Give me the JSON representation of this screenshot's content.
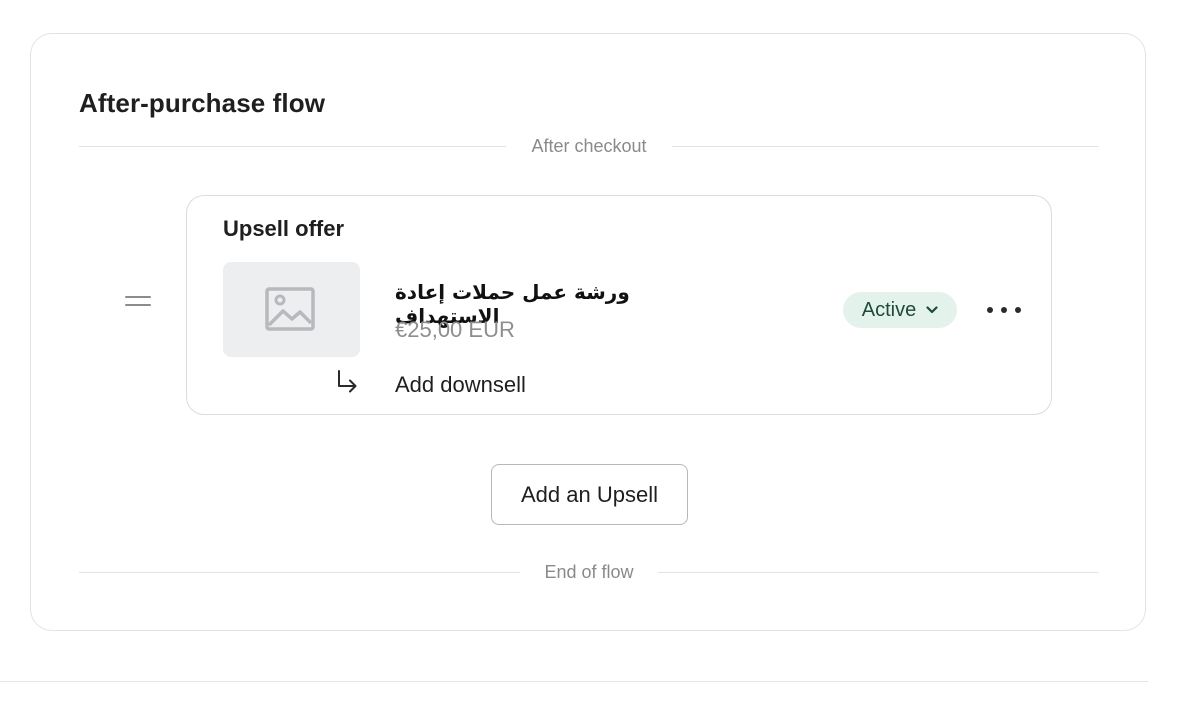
{
  "section": {
    "title": "After-purchase flow",
    "start_divider_label": "After checkout",
    "end_divider_label": "End of flow"
  },
  "offer": {
    "title": "Upsell offer",
    "product_name": "ورشة عمل حملات إعادة الاستهداف",
    "price": "€25,00 EUR",
    "status": "Active",
    "add_downsell_label": "Add downsell",
    "thumbnail_icon": "image-placeholder-icon",
    "menu_icon": "more-horizontal-icon"
  },
  "actions": {
    "add_upsell_label": "Add an Upsell"
  },
  "colors": {
    "status_bg": "#e3f3ec",
    "status_text": "#1f4a3a",
    "muted_text": "#8e8e8e",
    "border": "#dcdcdc"
  }
}
